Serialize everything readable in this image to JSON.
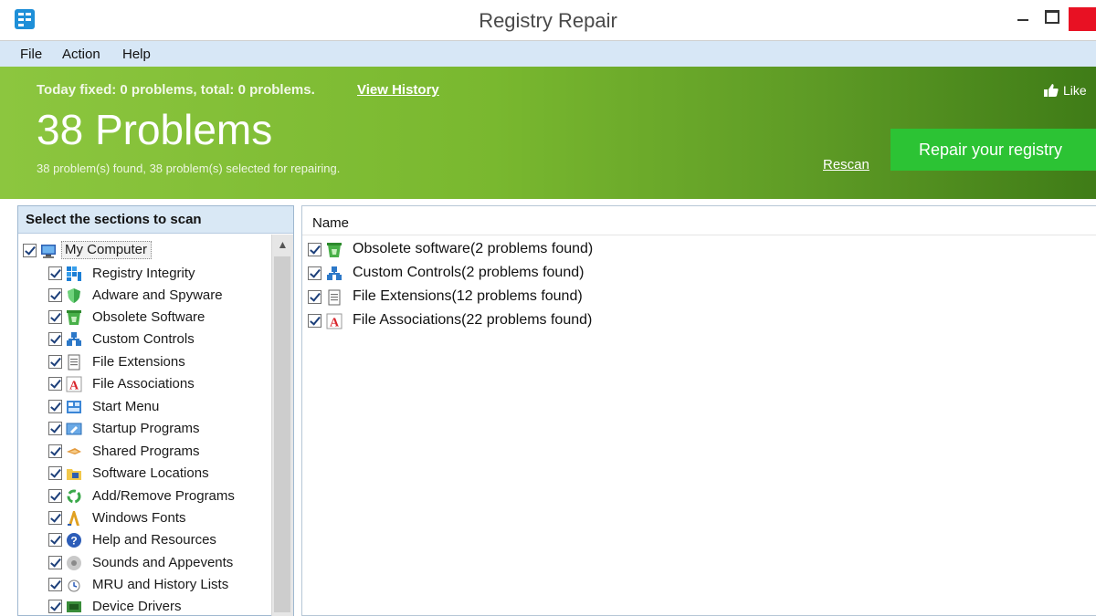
{
  "window": {
    "title": "Registry Repair"
  },
  "menu": [
    "File",
    "Action",
    "Help"
  ],
  "banner": {
    "today_fixed": "Today fixed: 0 problems, total: 0 problems.",
    "view_history": "View History",
    "problems": "38 Problems",
    "found_text": "38 problem(s) found, 38 problem(s) selected for repairing.",
    "rescan": "Rescan",
    "repair_button": "Repair your registry",
    "like": "Like"
  },
  "left_panel": {
    "header": "Select the sections to scan",
    "root": {
      "label": "My Computer",
      "checked": true,
      "icon": "computer-icon"
    },
    "items": [
      {
        "label": "Registry Integrity",
        "checked": true,
        "icon": "registry-icon"
      },
      {
        "label": "Adware and Spyware",
        "checked": true,
        "icon": "shield-icon"
      },
      {
        "label": "Obsolete Software",
        "checked": true,
        "icon": "recycle-bin-icon"
      },
      {
        "label": "Custom Controls",
        "checked": true,
        "icon": "controls-icon"
      },
      {
        "label": "File Extensions",
        "checked": true,
        "icon": "document-icon"
      },
      {
        "label": "File Associations",
        "checked": true,
        "icon": "letter-a-icon"
      },
      {
        "label": "Start Menu",
        "checked": true,
        "icon": "start-menu-icon"
      },
      {
        "label": "Startup Programs",
        "checked": true,
        "icon": "startup-icon"
      },
      {
        "label": "Shared Programs",
        "checked": true,
        "icon": "shared-icon"
      },
      {
        "label": "Software Locations",
        "checked": true,
        "icon": "folder-icon"
      },
      {
        "label": "Add/Remove Programs",
        "checked": true,
        "icon": "recycle-icon"
      },
      {
        "label": "Windows Fonts",
        "checked": true,
        "icon": "font-icon"
      },
      {
        "label": "Help and Resources",
        "checked": true,
        "icon": "help-icon"
      },
      {
        "label": "Sounds and Appevents",
        "checked": true,
        "icon": "sound-icon"
      },
      {
        "label": "MRU and History Lists",
        "checked": true,
        "icon": "history-icon"
      },
      {
        "label": "Device Drivers",
        "checked": true,
        "icon": "driver-icon"
      }
    ]
  },
  "right_panel": {
    "column_header": "Name",
    "rows": [
      {
        "label": "Obsolete software(2 problems found)",
        "checked": true,
        "icon": "recycle-bin-icon"
      },
      {
        "label": "Custom Controls(2 problems found)",
        "checked": true,
        "icon": "controls-icon"
      },
      {
        "label": "File Extensions(12 problems found)",
        "checked": true,
        "icon": "document-icon"
      },
      {
        "label": "File Associations(22 problems found)",
        "checked": true,
        "icon": "letter-a-icon"
      }
    ]
  },
  "colors": {
    "banner_green": "#79b82f",
    "button_green": "#2cc334",
    "menu_blue": "#d7e7f6"
  }
}
